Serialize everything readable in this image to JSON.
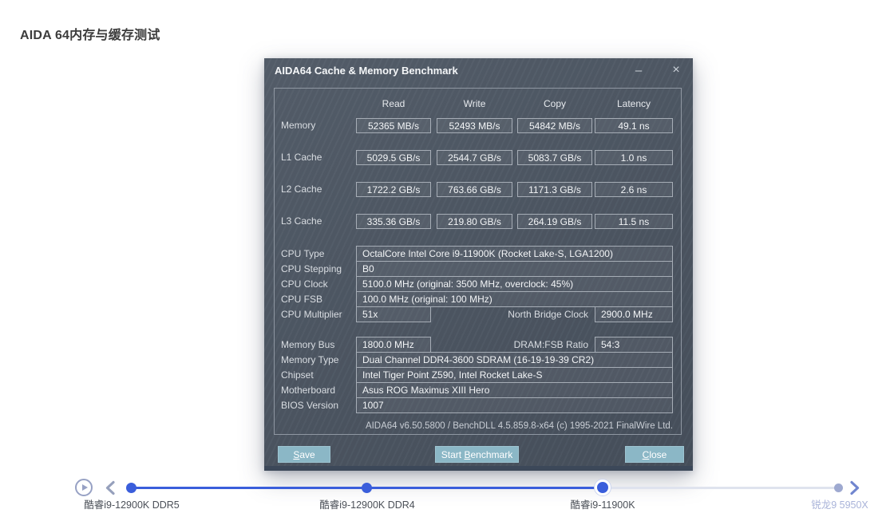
{
  "page": {
    "title": "AIDA 64内存与缓存测试"
  },
  "window": {
    "title": "AIDA64 Cache & Memory Benchmark",
    "minimize_glyph": "–",
    "close_glyph": "×",
    "bench": {
      "columns": [
        "Read",
        "Write",
        "Copy",
        "Latency"
      ],
      "rows": [
        {
          "label": "Memory",
          "values": [
            "52365 MB/s",
            "52493 MB/s",
            "54842 MB/s",
            "49.1 ns"
          ]
        },
        {
          "label": "L1 Cache",
          "values": [
            "5029.5 GB/s",
            "2544.7 GB/s",
            "5083.7 GB/s",
            "1.0 ns"
          ]
        },
        {
          "label": "L2 Cache",
          "values": [
            "1722.2 GB/s",
            "763.66 GB/s",
            "1171.3 GB/s",
            "2.6 ns"
          ]
        },
        {
          "label": "L3 Cache",
          "values": [
            "335.36 GB/s",
            "219.80 GB/s",
            "264.19 GB/s",
            "11.5 ns"
          ]
        }
      ]
    },
    "cpu_rows": [
      {
        "label": "CPU Type",
        "value": "OctalCore Intel Core i9-11900K  (Rocket Lake-S, LGA1200)"
      },
      {
        "label": "CPU Stepping",
        "value": "B0"
      },
      {
        "label": "CPU Clock",
        "value": "5100.0 MHz  (original: 3500 MHz, overclock: 45%)"
      },
      {
        "label": "CPU FSB",
        "value": "100.0 MHz  (original: 100 MHz)"
      },
      {
        "label": "CPU Multiplier",
        "value": "51x",
        "extra_label": "North Bridge Clock",
        "extra_value": "2900.0 MHz"
      }
    ],
    "mem_rows": [
      {
        "label": "Memory Bus",
        "value": "1800.0 MHz",
        "extra_label": "DRAM:FSB Ratio",
        "extra_value": "54:3"
      },
      {
        "label": "Memory Type",
        "value": "Dual Channel DDR4-3600 SDRAM  (16-19-19-39 CR2)"
      },
      {
        "label": "Chipset",
        "value": "Intel Tiger Point Z590, Intel Rocket Lake-S"
      },
      {
        "label": "Motherboard",
        "value": "Asus ROG Maximus XIII Hero"
      },
      {
        "label": "BIOS Version",
        "value": "1007"
      }
    ],
    "footer_version": "AIDA64 v6.50.5800 / BenchDLL 4.5.859.8-x64  (c) 1995-2021 FinalWire Ltd.",
    "buttons": {
      "save": {
        "u": "S",
        "rest": "ave"
      },
      "start": {
        "pre": "Start ",
        "u": "B",
        "rest": "enchmark"
      },
      "close": {
        "u": "C",
        "rest": "lose"
      }
    }
  },
  "timeline": {
    "items": [
      {
        "label": "酷睿i9-12900K DDR5",
        "state": "done"
      },
      {
        "label": "酷睿i9-12900K DDR4",
        "state": "done"
      },
      {
        "label": "酷睿i9-11900K",
        "state": "current"
      },
      {
        "label": "锐龙9 5950X",
        "state": "next"
      }
    ]
  },
  "colors": {
    "accent_blue": "#3a5edb",
    "inactive_periwinkle": "#9ea9d0",
    "button_teal": "#8bb7c6",
    "window_bg": "#4b5562"
  }
}
